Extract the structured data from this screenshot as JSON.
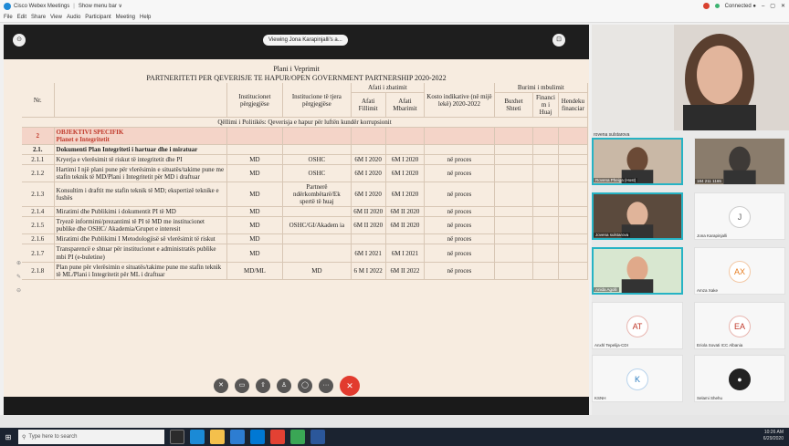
{
  "window": {
    "app_name": "Cisco Webex Meetings",
    "menu_bar_toggle": "Show menu bar ∨",
    "connection_status": "Connected ●",
    "menu": [
      "File",
      "Edit",
      "Share",
      "View",
      "Audio",
      "Participant",
      "Meeting",
      "Help"
    ]
  },
  "share": {
    "viewing_label": "Viewing Jona Karapinjalli's a..."
  },
  "document": {
    "plan_title": "Plani i Veprimit",
    "partnership_title": "PARTNERITETI PER QEVERISJE TE HAPUR/OPEN GOVERNMENT PARTNERSHIP 2020-2022",
    "headers": {
      "nr": "Nr.",
      "inst_resp": "Institucionet përgjegjëse",
      "inst_other": "Institucione të tjera përgjegjëse",
      "deadline": "Afati i zbatimit",
      "start": "Afati Fillimit",
      "end": "Afati Mbarimit",
      "cost": "Kosto indikative (në mijë lekë) 2020-2022",
      "funding": "Burimi i mbulimit",
      "state": "Buxhet Shteti",
      "foreign": "Financi m i Huaj",
      "gap": "Hendeku financiar"
    },
    "policy_goal": "Qëllimi i Politikës: Qeverisja e hapur për luftën kundër korrupsionit",
    "objective_nr": "2",
    "objective_title": "OBJEKTIVI SPECIFIK",
    "objective_sub": "Planet e Integritetit",
    "section_nr": "2.1.",
    "section_title": "Dokumenti Plan Integriteti i hartuar dhe i miratuar",
    "rows": [
      {
        "nr": "2.1.1",
        "act": "Kryerja e vlerësimit të riskut të integritetit dhe PI",
        "resp": "MD",
        "other": "OSHC",
        "start": "6M I 2020",
        "end": "6M I 2020",
        "status": "në proces"
      },
      {
        "nr": "2.1.2",
        "act": "Hartimi I një plani pune për vlerësimin e situatës/takime pune me stafin teknik të MD/Plani i Integritetit për MD i draftuar",
        "resp": "MD",
        "other": "OSHC",
        "start": "6M I 2020",
        "end": "6M I 2020",
        "status": "në proces"
      },
      {
        "nr": "2.1.3",
        "act": "Konsultim i draftit me stafin teknik të MD; ekspertizë teknike e fushës",
        "resp": "MD",
        "other": "Partnerë ndërkombëtarë/Ek spertë të huaj",
        "start": "6M I 2020",
        "end": "6M I 2020",
        "status": "në proces"
      },
      {
        "nr": "2.1.4",
        "act": "Miratimi dhe Publikimi i dokumentit PI të MD",
        "resp": "MD",
        "other": "",
        "start": "6M II 2020",
        "end": "6M II 2020",
        "status": "në proces"
      },
      {
        "nr": "2.1.5",
        "act": "Tryezë informimi/prezantimi të PI të MD me institucionet publike dhe OSHC/ Akademia/Grupet e interesit",
        "resp": "MD",
        "other": "OSHC/GI/Akadem ia",
        "start": "6M II 2020",
        "end": "6M II 2020",
        "status": "në proces"
      },
      {
        "nr": "2.1.6",
        "act": "Miratimi dhe Publikimi I Metodologjisë së vlerësimit të riskut",
        "resp": "MD",
        "other": "",
        "start": "",
        "end": "",
        "status": "në proces"
      },
      {
        "nr": "2.1.7",
        "act": "Transparencë e shtuar për institucionet e administratës publike mbi PI (e-buletine)",
        "resp": "MD",
        "other": "",
        "start": "6M I 2021",
        "end": "6M I 2021",
        "status": "në proces"
      },
      {
        "nr": "2.1.8",
        "act": "Plan pune për vlerësimin e situatës/takime pune me stafin teknik të ML/Plani i Integritetit për ML i draftuar",
        "resp": "MD/ML",
        "other": "MD",
        "start": "6 M I 2022",
        "end": "6M II 2022",
        "status": "në proces"
      }
    ]
  },
  "participants": {
    "speaker_label": "rovena sulstarova",
    "tiles": [
      {
        "name": "Rovena Pheiga (Host)",
        "kind": "video"
      },
      {
        "name": "184 211 1165",
        "kind": "video"
      },
      {
        "name": "Jovena sulstarova",
        "kind": "video"
      },
      {
        "name": "Jona Karapinjalli",
        "kind": "avatar",
        "initials": "J"
      },
      {
        "name": "Anida Agolli",
        "kind": "video"
      },
      {
        "name": "Amza Xake",
        "kind": "avatar",
        "initials": "AX"
      },
      {
        "name": "Anxhl Tepelija-CDI",
        "kind": "avatar",
        "initials": "AT"
      },
      {
        "name": "Eriola Sovati ICC Albania",
        "kind": "avatar",
        "initials": "EA"
      },
      {
        "name": "KSNH",
        "kind": "avatar",
        "initials": "K"
      },
      {
        "name": "Selami Shehu",
        "kind": "avatar",
        "initials": "●"
      }
    ]
  },
  "taskbar": {
    "search_placeholder": "Type here to search",
    "time": "10:26 AM",
    "date": "6/29/2020"
  },
  "colors": {
    "doc_bg": "#f7ece0",
    "accent_red": "#c0392b",
    "leave_button": "#e23b2e",
    "active_tile": "#26b3c4"
  }
}
